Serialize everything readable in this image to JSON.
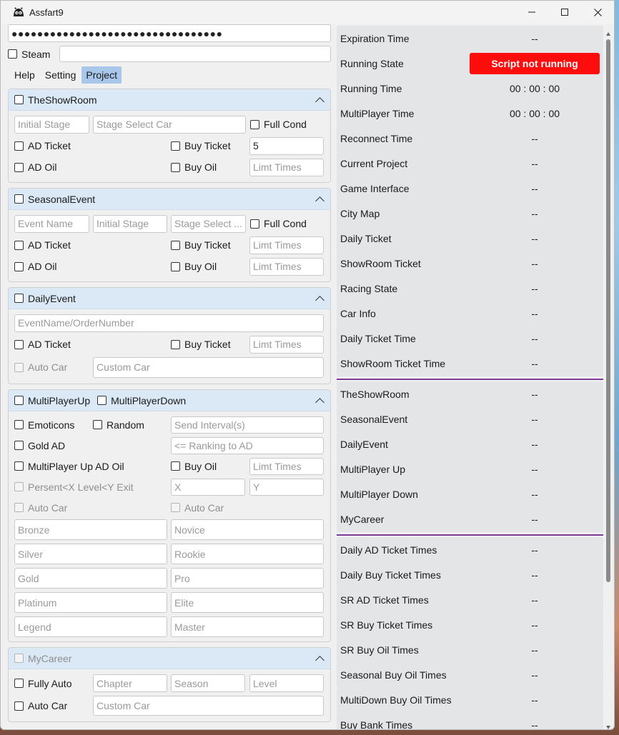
{
  "window": {
    "title": "Assfart9",
    "minimize": "—",
    "maximize": "☐",
    "close": "✕"
  },
  "account": {
    "password_masked": "●●●●●●●●●●●●●●●●●●●●●●●●●●●●●●●●●",
    "steam_label": "Steam",
    "steam_value": ""
  },
  "tabs": [
    {
      "label": "Help"
    },
    {
      "label": "Setting"
    },
    {
      "label": "Project"
    }
  ],
  "showroom": {
    "title": "TheShowRoom",
    "initial_stage_ph": "Initial Stage",
    "stage_select_car_ph": "Stage Select Car",
    "full_cond": "Full Cond",
    "ad_ticket": "AD Ticket",
    "buy_ticket": "Buy Ticket",
    "buy_ticket_value": "5",
    "ad_oil": "AD Oil",
    "buy_oil": "Buy Oil",
    "limit_times_ph": "Limt Times"
  },
  "seasonal": {
    "title": "SeasonalEvent",
    "event_name_ph": "Event Name",
    "initial_stage_ph": "Initial Stage",
    "stage_select_ph": "Stage Select ...",
    "full_cond": "Full Cond",
    "ad_ticket": "AD Ticket",
    "buy_ticket": "Buy Ticket",
    "limit_times_ph": "Limt Times",
    "ad_oil": "AD Oil",
    "buy_oil": "Buy Oil",
    "limit_times2_ph": "Limt Times"
  },
  "daily": {
    "title": "DailyEvent",
    "event_order_ph": "EventName/OrderNumber",
    "ad_ticket": "AD Ticket",
    "buy_ticket": "Buy Ticket",
    "limit_times_ph": "Limt Times",
    "auto_car": "Auto Car",
    "custom_car_ph": "Custom Car"
  },
  "multiplayer": {
    "up": "MultiPlayerUp",
    "down": "MultiPlayerDown",
    "emoticons": "Emoticons",
    "random": "Random",
    "send_interval_ph": "Send Interval(s)",
    "gold_ad": "Gold AD",
    "ranking_ph": "<= Ranking to AD",
    "up_ad_oil": "MultiPlayer Up AD Oil",
    "buy_oil": "Buy Oil",
    "limit_times_ph": "Limt Times",
    "persent_exit": "Persent<X Level<Y Exit",
    "x_ph": "X",
    "y_ph": "Y",
    "auto_car_1": "Auto Car",
    "auto_car_2": "Auto Car",
    "ranks_left": [
      "Bronze",
      "Silver",
      "Gold",
      "Platinum",
      "Legend"
    ],
    "ranks_right": [
      "Novice",
      "Rookie",
      "Pro",
      "Elite",
      "Master"
    ]
  },
  "mycareer": {
    "title": "MyCareer",
    "fully_auto": "Fully Auto",
    "chapter_ph": "Chapter",
    "season_ph": "Season",
    "level_ph": "Level",
    "auto_car": "Auto Car",
    "custom_car_ph": "Custom Car"
  },
  "status": {
    "group1": [
      {
        "key": "Expiration Time",
        "value": "--"
      },
      {
        "key": "Running State",
        "value": "Script not running"
      },
      {
        "key": "Running Time",
        "value": "00 : 00 : 00"
      },
      {
        "key": "MultiPlayer Time",
        "value": "00 : 00 : 00"
      },
      {
        "key": "Reconnect Time",
        "value": "--"
      },
      {
        "key": "Current Project",
        "value": "--"
      },
      {
        "key": "Game Interface",
        "value": "--"
      },
      {
        "key": "City Map",
        "value": "--"
      },
      {
        "key": "Daily Ticket",
        "value": "--"
      },
      {
        "key": "ShowRoom Ticket",
        "value": "--"
      },
      {
        "key": "Racing State",
        "value": "--"
      },
      {
        "key": "Car Info",
        "value": "--"
      },
      {
        "key": "Daily Ticket Time",
        "value": "--"
      },
      {
        "key": "ShowRoom Ticket Time",
        "value": "--"
      }
    ],
    "group2": [
      {
        "key": "TheShowRoom",
        "value": "--"
      },
      {
        "key": "SeasonalEvent",
        "value": "--"
      },
      {
        "key": "DailyEvent",
        "value": "--"
      },
      {
        "key": "MultiPlayer Up",
        "value": "--"
      },
      {
        "key": "MultiPlayer Down",
        "value": "--"
      },
      {
        "key": "MyCareer",
        "value": "--"
      }
    ],
    "group3": [
      {
        "key": "Daily AD Ticket Times",
        "value": "--"
      },
      {
        "key": "Daily Buy Ticket Times",
        "value": "--"
      },
      {
        "key": "SR AD Ticket Times",
        "value": "--"
      },
      {
        "key": "SR Buy Ticket Times",
        "value": "--"
      },
      {
        "key": "SR Buy Oil Times",
        "value": "--"
      },
      {
        "key": "Seasonal Buy Oil Times",
        "value": "--"
      },
      {
        "key": "MultiDown Buy Oil Times",
        "value": "--"
      },
      {
        "key": "Buy Bank Times",
        "value": "--"
      }
    ]
  },
  "colors": {
    "running_state_badge": "#ff0c0c",
    "divider": "#7a3c96",
    "active_tab": "#a8c7ea",
    "group_header": "#dbe8f5"
  }
}
